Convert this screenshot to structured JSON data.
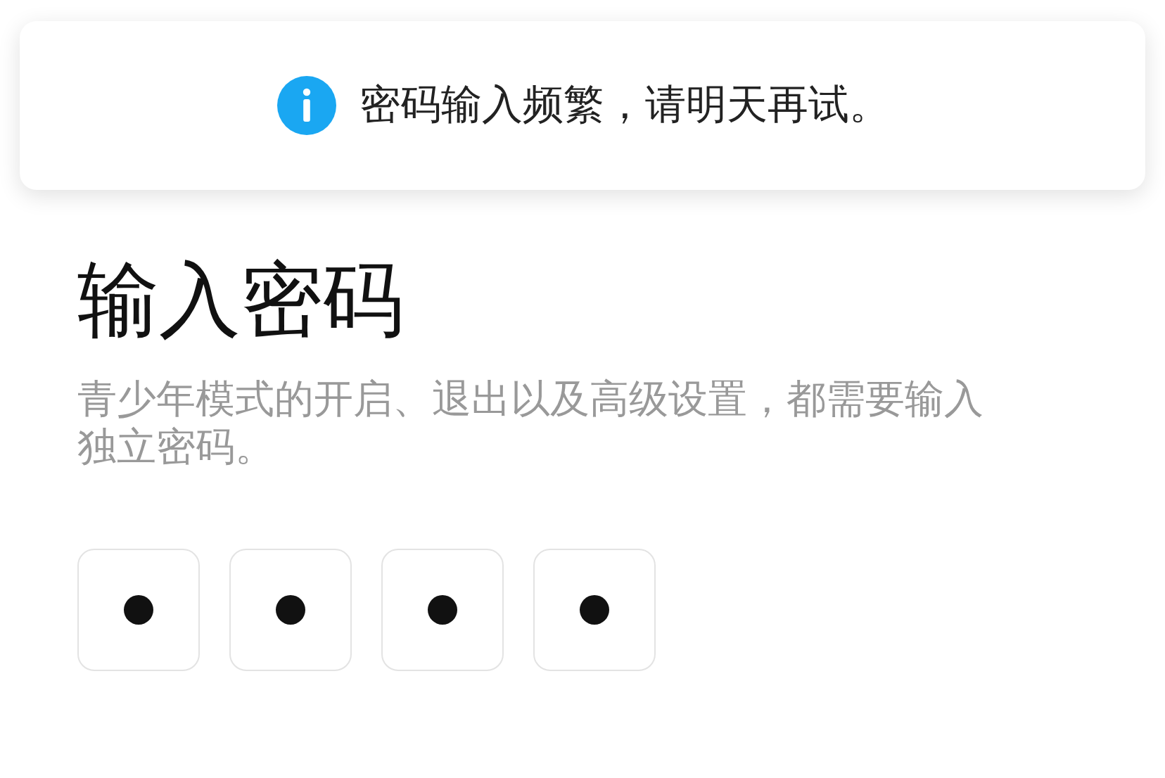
{
  "toast": {
    "message": "密码输入频繁，请明天再试。"
  },
  "title": "输入密码",
  "description": "青少年模式的开启、退出以及高级设置，都需要输入独立密码。",
  "pin_boxes": [
    {
      "filled": true
    },
    {
      "filled": true
    },
    {
      "filled": true
    },
    {
      "filled": true
    }
  ]
}
